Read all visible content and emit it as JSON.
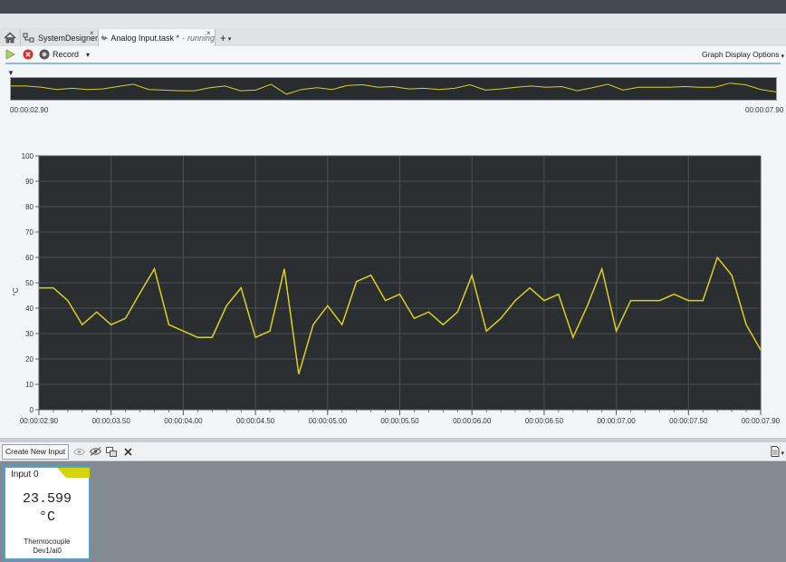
{
  "tabs": {
    "home_label": "",
    "system_designer": "SystemDesigner",
    "analog_input_title": "Analog Input.task *",
    "analog_input_status": "running",
    "close_glyph": "×",
    "add_glyph": "+",
    "dropdown_glyph": "▾"
  },
  "command_bar": {
    "record_label": "Record",
    "graph_display_options": "Graph Display Options"
  },
  "overview": {
    "start_time": "00:00:02.90",
    "end_time": "00:00:07.90"
  },
  "chart_data": {
    "type": "line",
    "ylabel": "°C",
    "ylim": [
      0,
      100
    ],
    "yticks": [
      0,
      10,
      20,
      30,
      40,
      50,
      60,
      70,
      80,
      90,
      100
    ],
    "xlim": [
      2.9,
      7.9
    ],
    "xtick_values": [
      2.9,
      3.4,
      3.9,
      4.4,
      4.9,
      5.4,
      5.9,
      6.4,
      6.9,
      7.4,
      7.9
    ],
    "xtick_labels": [
      "00:00:02.90",
      "00:00:03.50",
      "00:00:04.00",
      "00:00:04.50",
      "00:00:05.00",
      "00:00:05.50",
      "00:00:06.00",
      "00:00:06.50",
      "00:00:07.00",
      "00:00:07.50",
      "00:00:07.90"
    ],
    "grid": true,
    "colors": {
      "background": "#2a2e31",
      "line": "#d8d21e",
      "grid": "#4a5054"
    },
    "x": [
      2.9,
      3.0,
      3.1,
      3.2,
      3.3,
      3.4,
      3.5,
      3.6,
      3.7,
      3.8,
      3.9,
      4.0,
      4.1,
      4.2,
      4.3,
      4.4,
      4.5,
      4.6,
      4.7,
      4.8,
      4.9,
      5.0,
      5.1,
      5.2,
      5.3,
      5.4,
      5.5,
      5.6,
      5.7,
      5.8,
      5.9,
      6.0,
      6.1,
      6.2,
      6.3,
      6.4,
      6.5,
      6.6,
      6.7,
      6.8,
      6.9,
      7.0,
      7.1,
      7.2,
      7.3,
      7.4,
      7.5,
      7.6,
      7.7,
      7.8,
      7.9,
      8.0
    ],
    "values": [
      48,
      48,
      43,
      33.5,
      38.5,
      33.5,
      36,
      46,
      55.5,
      33.5,
      31,
      28.5,
      28.5,
      41,
      48,
      28.5,
      31,
      55.5,
      14,
      33.5,
      41,
      33.5,
      50.5,
      53,
      43,
      45.5,
      36,
      38.5,
      33.5,
      38.5,
      53,
      31,
      36,
      43,
      48,
      43,
      45.5,
      28.5,
      41,
      55.5,
      31,
      43,
      43,
      43,
      45.5,
      43,
      43,
      60,
      53,
      33.5,
      23.6,
      23.6
    ],
    "overview_values": [
      48,
      48,
      43,
      33.5,
      38.5,
      33.5,
      36,
      46,
      55.5,
      33.5,
      31,
      28.5,
      28.5,
      41,
      48,
      28.5,
      31,
      55.5,
      14,
      33.5,
      41,
      33.5,
      50.5,
      53,
      43,
      45.5,
      36,
      38.5,
      33.5,
      38.5,
      53,
      31,
      36,
      43,
      48,
      43,
      45.5,
      28.5,
      41,
      55.5,
      31,
      43,
      43,
      43,
      45.5,
      43,
      43,
      60,
      53,
      33.5,
      23.6,
      23.6
    ]
  },
  "inputs_panel": {
    "create_button": "Create New Input"
  },
  "input_card": {
    "title": "Input 0",
    "value": "23.599",
    "unit": "°C",
    "type": "Thermocouple",
    "channel": "Dev1/ai0",
    "tag_color": "#d4d40c"
  }
}
